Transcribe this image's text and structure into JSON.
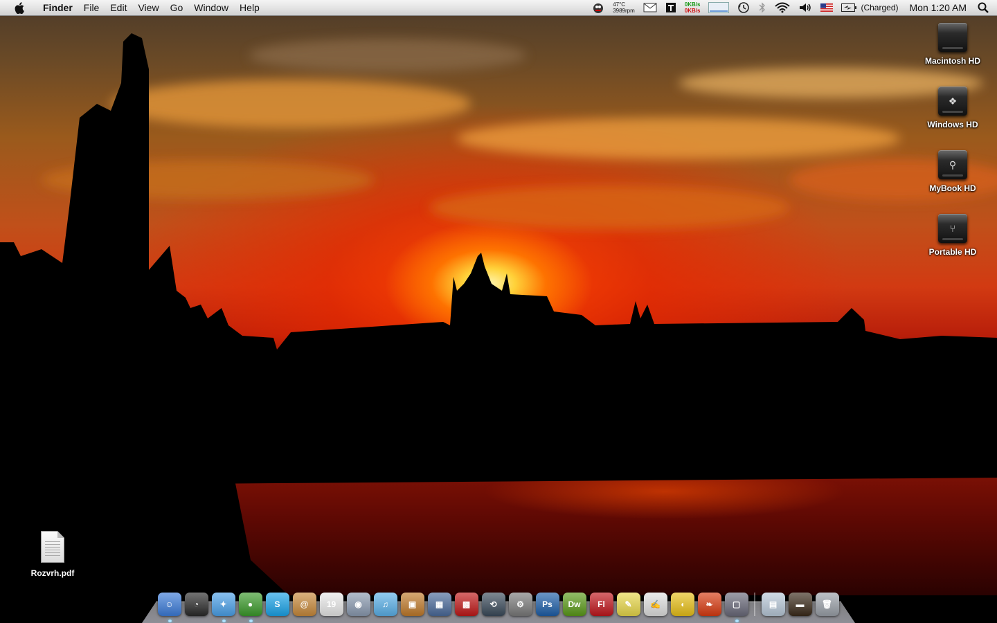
{
  "menubar": {
    "app_name": "Finder",
    "menus": [
      "File",
      "Edit",
      "View",
      "Go",
      "Window",
      "Help"
    ],
    "status": {
      "temperature": "47°C",
      "fan": "3989rpm",
      "net_up": "0KB/s",
      "net_down": "0KB/s",
      "battery": "(Charged)",
      "clock": "Mon 1:20 AM"
    },
    "icons": [
      "apple-icon",
      "system-monitor-icon",
      "mail-icon",
      "notes-icon",
      "network-meter-icon",
      "time-machine-icon",
      "bluetooth-icon",
      "wifi-icon",
      "volume-icon",
      "us-flag-icon",
      "battery-icon",
      "spotlight-icon"
    ]
  },
  "desktop": {
    "drives": [
      {
        "label": "Macintosh HD",
        "glyph": ""
      },
      {
        "label": "Windows HD",
        "glyph": "❖"
      },
      {
        "label": "MyBook HD",
        "glyph": "⚲"
      },
      {
        "label": "Portable HD",
        "glyph": "⑂"
      }
    ],
    "files": [
      {
        "label": "Rozvrh.pdf"
      }
    ]
  },
  "dock": {
    "apps": [
      {
        "name": "finder-icon",
        "glyph": "☺",
        "color": "#3b7bd8",
        "running": true
      },
      {
        "name": "dashboard-icon",
        "glyph": "◔",
        "color": "#2a2a2a",
        "running": false
      },
      {
        "name": "safari-icon",
        "glyph": "✦",
        "color": "#4aa0e8",
        "running": true
      },
      {
        "name": "adium-icon",
        "glyph": "●",
        "color": "#3a9a2a",
        "running": true
      },
      {
        "name": "skype-icon",
        "glyph": "S",
        "color": "#1aa3e8",
        "running": false
      },
      {
        "name": "address-book-icon",
        "glyph": "@",
        "color": "#c8893a",
        "running": false
      },
      {
        "name": "ical-icon",
        "glyph": "19",
        "color": "#e8e8e8",
        "running": false
      },
      {
        "name": "preview-icon",
        "glyph": "◉",
        "color": "#8a9ab0",
        "running": false
      },
      {
        "name": "itunes-icon",
        "glyph": "♫",
        "color": "#5ab0e8",
        "running": false
      },
      {
        "name": "iphoto-icon",
        "glyph": "▣",
        "color": "#c07a2a",
        "running": false
      },
      {
        "name": "spaces-icon",
        "glyph": "▦",
        "color": "#4a6a9a",
        "running": false
      },
      {
        "name": "photo-booth-icon",
        "glyph": "▩",
        "color": "#c01818",
        "running": false
      },
      {
        "name": "time-machine-icon",
        "glyph": "⟲",
        "color": "#3a4a5a",
        "running": false
      },
      {
        "name": "system-preferences-icon",
        "glyph": "⚙",
        "color": "#7a7a7a",
        "running": false
      },
      {
        "name": "photoshop-icon",
        "glyph": "Ps",
        "color": "#1d5ea8",
        "running": false
      },
      {
        "name": "dreamweaver-icon",
        "glyph": "Dw",
        "color": "#5a9a18",
        "running": false
      },
      {
        "name": "flash-icon",
        "glyph": "Fl",
        "color": "#c0161c",
        "running": false
      },
      {
        "name": "stickies-icon",
        "glyph": "✎",
        "color": "#e8d84a",
        "running": false
      },
      {
        "name": "textedit-icon",
        "glyph": "✍",
        "color": "#e0e0e0",
        "running": false
      },
      {
        "name": "cyberduck-icon",
        "glyph": "◖",
        "color": "#e8c018",
        "running": false
      },
      {
        "name": "flashget-icon",
        "glyph": "❧",
        "color": "#d83a10",
        "running": false
      },
      {
        "name": "vmware-fusion-icon",
        "glyph": "▢",
        "color": "#6a6a7a",
        "running": true
      }
    ],
    "stacks": [
      {
        "name": "documents-stack-icon",
        "glyph": "▤",
        "color": "#b8c8d8"
      },
      {
        "name": "downloads-stack-icon",
        "glyph": "▬",
        "color": "#3a2a1a"
      },
      {
        "name": "trash-icon",
        "glyph": "🗑",
        "color": "#9aa0a8"
      }
    ]
  }
}
